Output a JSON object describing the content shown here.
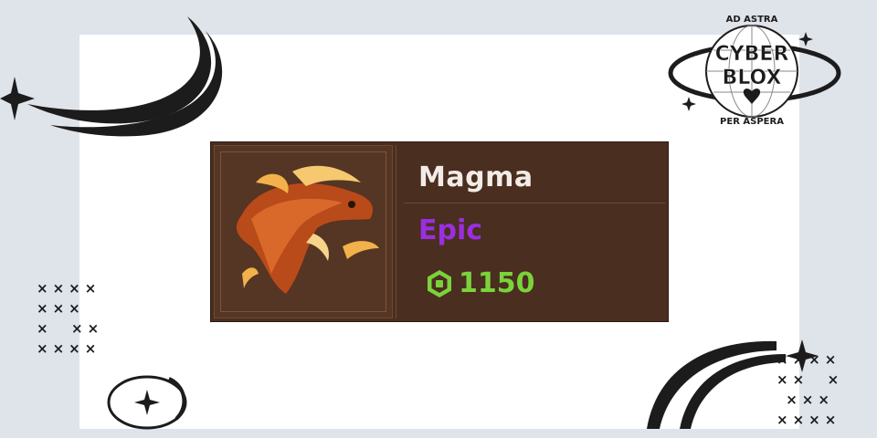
{
  "item": {
    "name": "Magma",
    "rarity": "Epic",
    "price": "1150",
    "image_icon": "magma-dragon-icon",
    "currency_icon": "robux-icon"
  },
  "logo": {
    "top_text": "AD ASTRA",
    "line1": "CYBER",
    "line2": "BLOX",
    "bottom_text": "PER ASPERA"
  },
  "colors": {
    "card_bg": "#4a2e20",
    "name": "#f2ece6",
    "rarity_epic": "#9a2ee0",
    "price": "#7ad33a",
    "background": "#dfe3ea"
  }
}
